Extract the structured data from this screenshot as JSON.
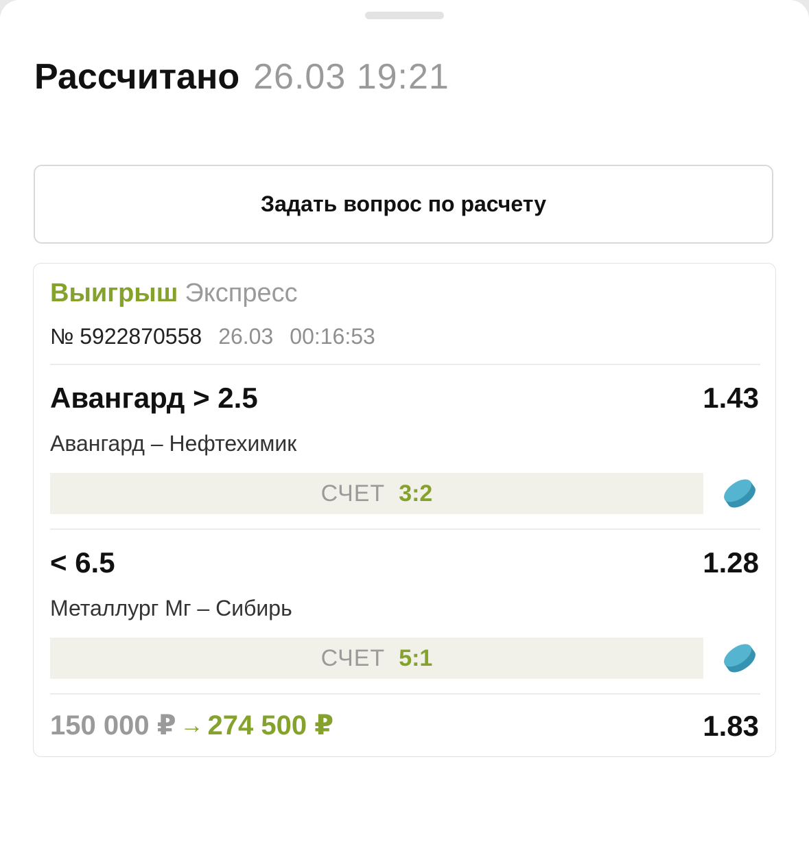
{
  "header": {
    "title": "Рассчитано",
    "datetime": "26.03 19:21"
  },
  "ask_button_label": "Задать вопрос по расчету",
  "bet": {
    "status": "Выигрыш",
    "type": "Экспресс",
    "number": "№ 5922870558",
    "date": "26.03",
    "time": "00:16:53",
    "selections": [
      {
        "name": "Авангард > 2.5",
        "odds": "1.43",
        "match": "Авангард – Нефтехимик",
        "score_label": "СЧЕТ",
        "score": "3:2",
        "icon": "hockey-puck-icon"
      },
      {
        "name": "< 6.5",
        "odds": "1.28",
        "match": "Металлург Мг – Сибирь",
        "score_label": "СЧЕТ",
        "score": "5:1",
        "icon": "hockey-puck-icon"
      }
    ],
    "stake": "150 000 ₽",
    "arrow": "→",
    "payout": "274 500 ₽",
    "total_odds": "1.83"
  },
  "colors": {
    "win_green": "#85a32c",
    "muted_gray": "#9a9a9a",
    "puck_blue": "#4aa8c4",
    "score_bar_bg": "#f1f1ea"
  }
}
